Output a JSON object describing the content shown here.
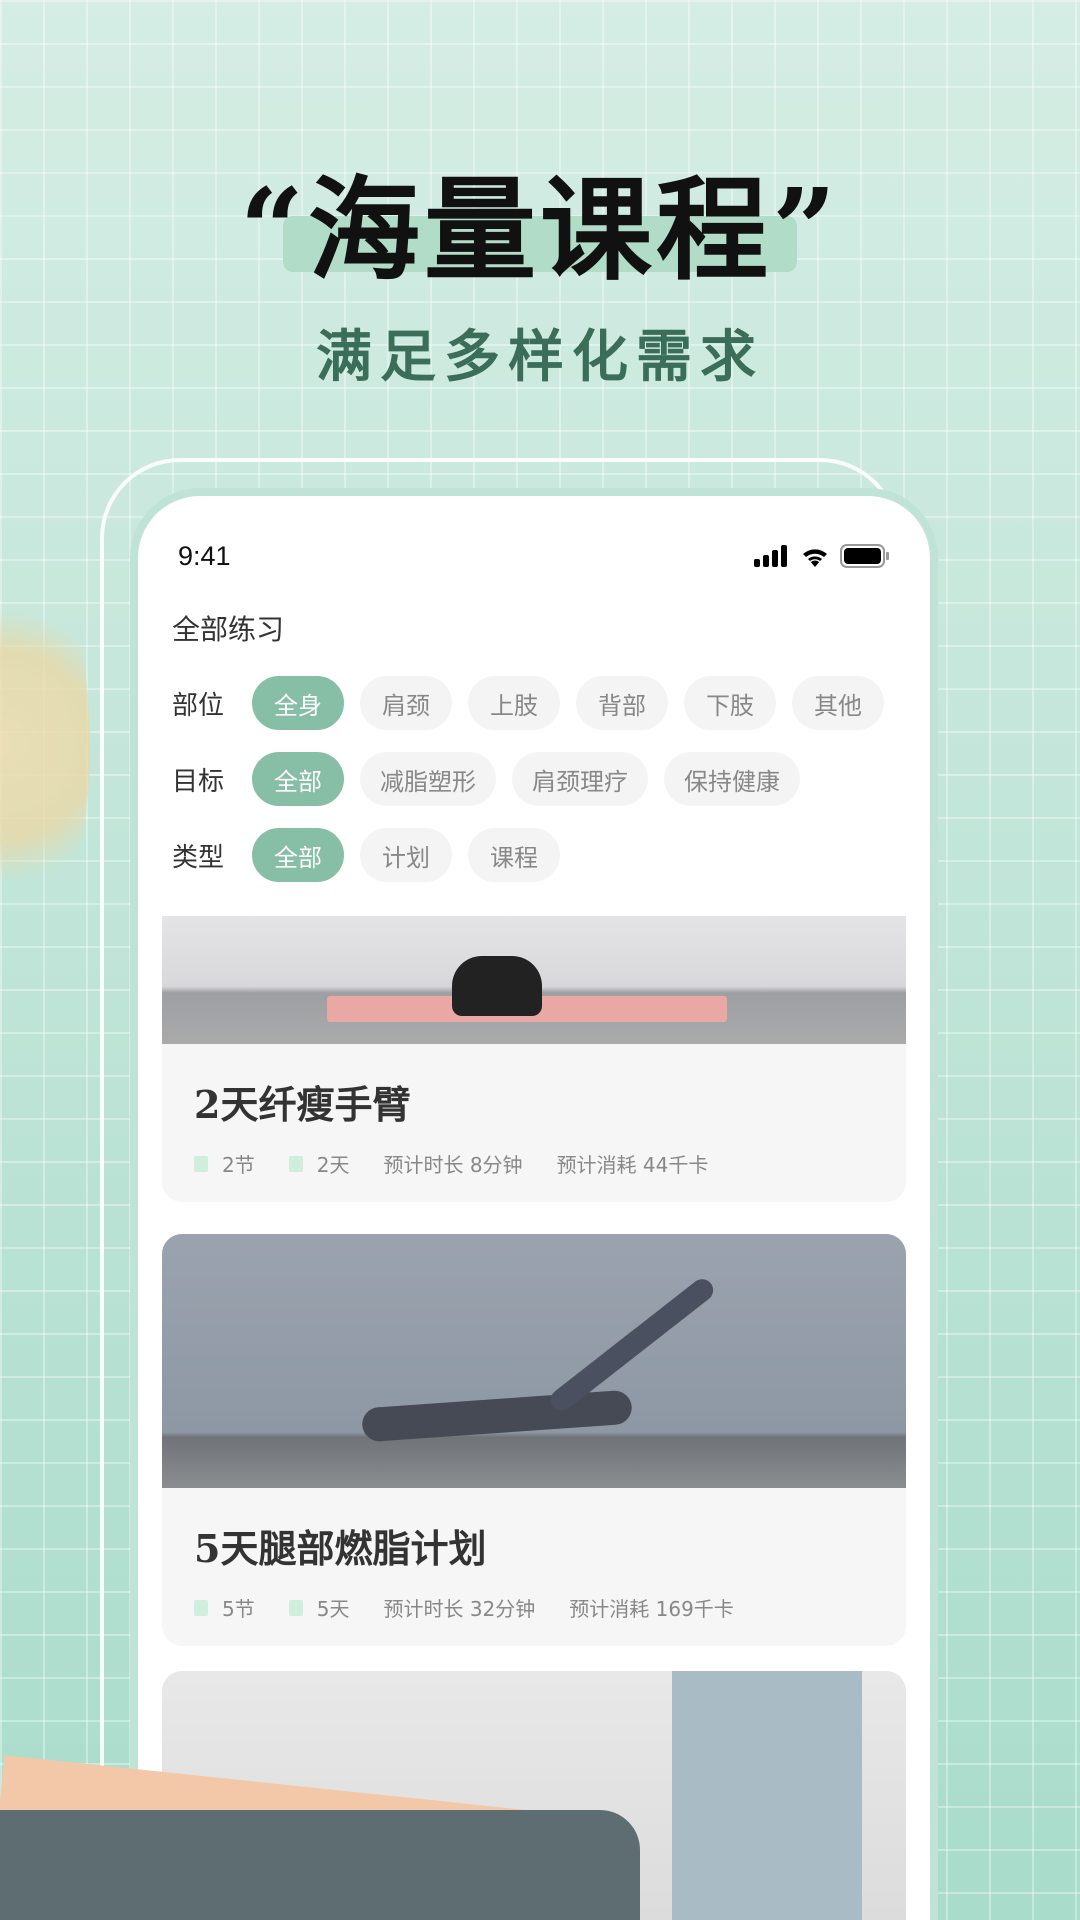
{
  "promo": {
    "headline": "“海量课程”",
    "subtitle": "满足多样化需求"
  },
  "status_bar": {
    "time": "9:41",
    "icons": [
      "signal-icon",
      "wifi-icon",
      "battery-icon"
    ]
  },
  "section_title": "全部练习",
  "filters": [
    {
      "label": "部位",
      "options": [
        "全身",
        "肩颈",
        "上肢",
        "背部",
        "下肢",
        "其他"
      ],
      "selected": "全身"
    },
    {
      "label": "目标",
      "options": [
        "全部",
        "减脂塑形",
        "肩颈理疗",
        "保持健康"
      ],
      "selected": "全部"
    },
    {
      "label": "类型",
      "options": [
        "全部",
        "计划",
        "课程"
      ],
      "selected": "全部"
    }
  ],
  "courses": [
    {
      "title": "2天纤瘦手臂",
      "sessions": "2节",
      "days": "2天",
      "duration": "预计时长 8分钟",
      "calories": "预计消耗 44千卡"
    },
    {
      "title": "5天腿部燃脂计划",
      "sessions": "5节",
      "days": "5天",
      "duration": "预计时长 32分钟",
      "calories": "预计消耗 169千卡"
    }
  ],
  "colors": {
    "accent": "#86bea6",
    "background": "#c4e6da"
  }
}
